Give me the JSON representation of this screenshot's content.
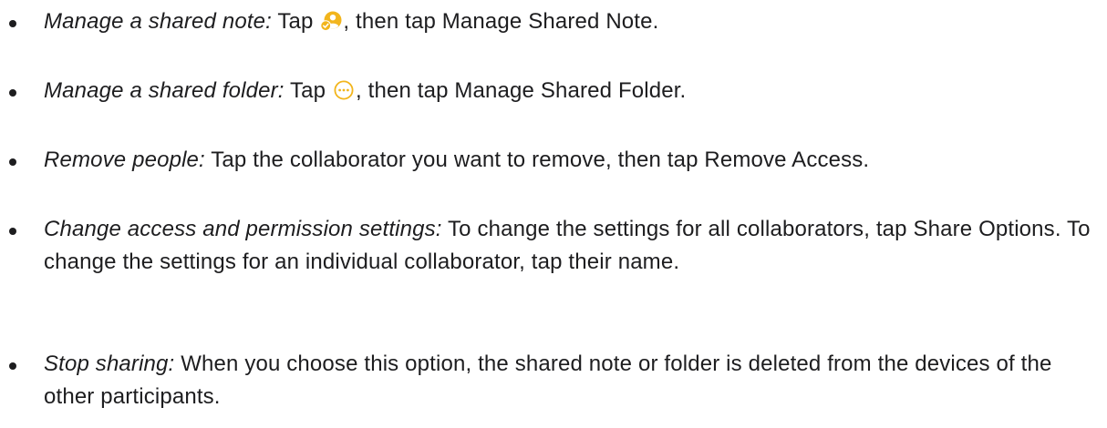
{
  "items": [
    {
      "term": "Manage a shared note:",
      "before": "Tap",
      "icon": "shared-note-collaboration-icon",
      "after": ", then tap Manage Shared Note."
    },
    {
      "term": "Manage a shared folder:",
      "before": "Tap",
      "icon": "more-ellipsis-circle-icon",
      "after": ", then tap Manage Shared Folder."
    },
    {
      "term": "Remove people:",
      "body": "Tap the collaborator you want to remove, then tap Remove Access."
    },
    {
      "term": "Change access and permission settings:",
      "body": "To change the settings for all collaborators, tap Share Options. To change the settings for an individual collaborator, tap their name."
    },
    {
      "term": "Stop sharing:",
      "body": "When you choose this option, the shared note or folder is deleted from the devices of the other participants."
    }
  ],
  "colors": {
    "text": "#1d1d1f",
    "icon_accent": "#F2B51C",
    "background": "#ffffff"
  }
}
